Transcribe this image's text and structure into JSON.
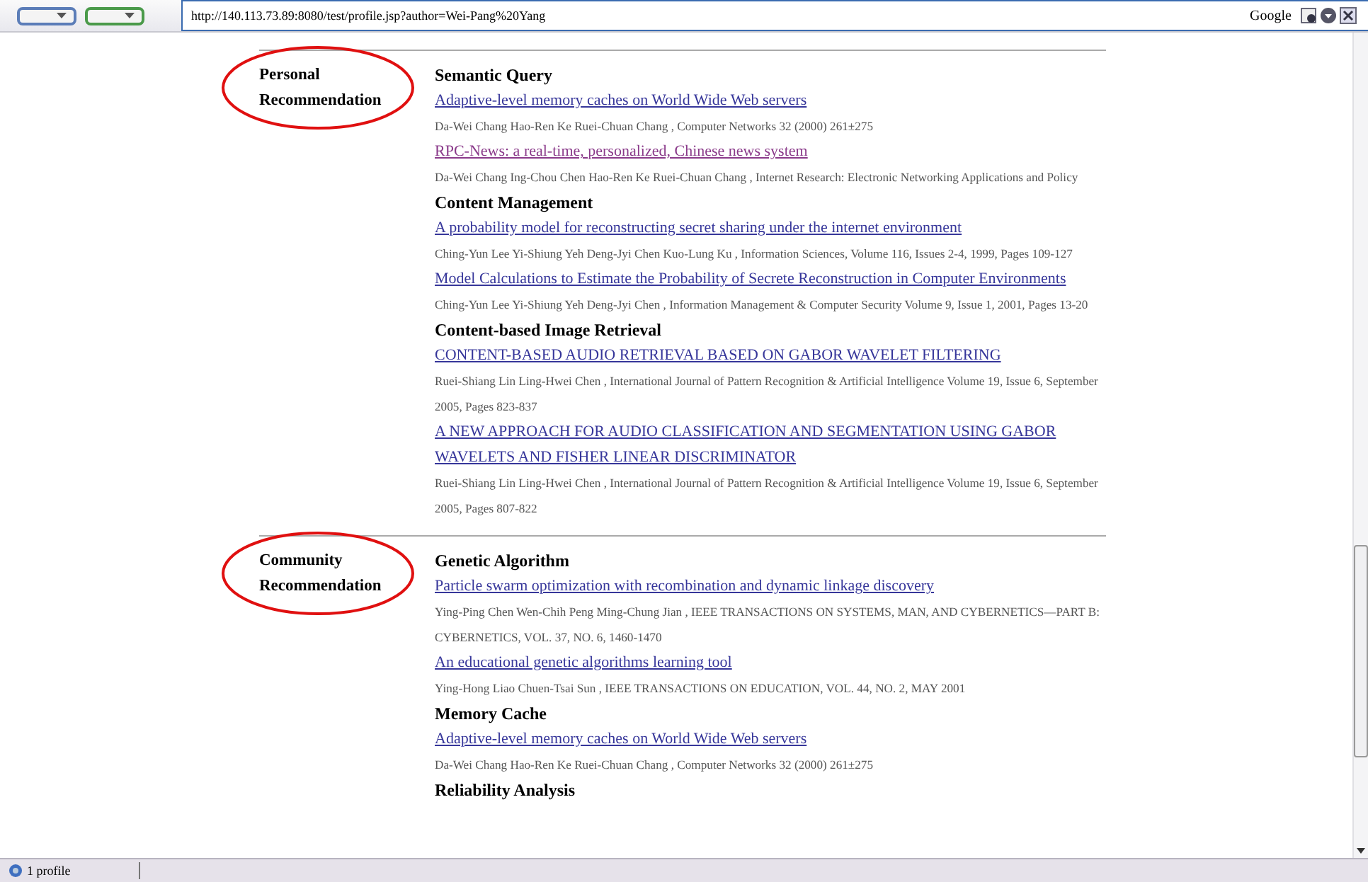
{
  "toolbar": {
    "address": "http://140.113.73.89:8080/test/profile.jsp?author=Wei-Pang%20Yang",
    "search_label": "Google"
  },
  "sections": [
    {
      "label": "Personal Recommendation",
      "groups": [
        {
          "topic": "Semantic Query",
          "papers": [
            {
              "title": "Adaptive-level memory caches on World Wide Web servers",
              "visited": false,
              "meta": "Da-Wei Chang Hao-Ren Ke Ruei-Chuan Chang , Computer Networks 32 (2000) 261±275"
            },
            {
              "title": "RPC-News: a real-time, personalized, Chinese news system",
              "visited": true,
              "meta": "Da-Wei Chang Ing-Chou Chen Hao-Ren Ke Ruei-Chuan Chang , Internet Research: Electronic Networking Applications and Policy"
            }
          ]
        },
        {
          "topic": "Content Management",
          "papers": [
            {
              "title": "A probability model for reconstructing secret sharing under the internet environment",
              "visited": false,
              "meta": "Ching-Yun Lee Yi-Shiung Yeh Deng-Jyi Chen Kuo-Lung Ku , Information Sciences, Volume 116, Issues 2-4, 1999, Pages 109-127"
            },
            {
              "title": "Model Calculations to Estimate the Probability of Secrete Reconstruction in Computer Environments",
              "visited": false,
              "meta": "Ching-Yun Lee Yi-Shiung Yeh Deng-Jyi Chen , Information Management & Computer Security Volume 9, Issue 1, 2001, Pages 13-20"
            }
          ]
        },
        {
          "topic": "Content-based Image Retrieval",
          "papers": [
            {
              "title": "CONTENT-BASED AUDIO RETRIEVAL BASED ON GABOR WAVELET FILTERING",
              "visited": false,
              "meta": "Ruei-Shiang Lin Ling-Hwei Chen , International Journal of Pattern Recognition & Artificial Intelligence Volume 19, Issue 6, September 2005, Pages 823-837"
            },
            {
              "title": "A NEW APPROACH FOR AUDIO CLASSIFICATION AND SEGMENTATION USING GABOR WAVELETS AND FISHER LINEAR DISCRIMINATOR",
              "visited": false,
              "meta": "Ruei-Shiang Lin Ling-Hwei Chen , International Journal of Pattern Recognition & Artificial Intelligence Volume 19, Issue 6, September 2005, Pages 807-822"
            }
          ]
        }
      ]
    },
    {
      "label": "Community Recommendation",
      "groups": [
        {
          "topic": "Genetic Algorithm",
          "papers": [
            {
              "title": "Particle swarm optimization with recombination and dynamic linkage discovery",
              "visited": false,
              "meta": "Ying-Ping Chen Wen-Chih Peng Ming-Chung Jian , IEEE TRANSACTIONS ON SYSTEMS, MAN, AND CYBERNETICS—PART B: CYBERNETICS, VOL. 37, NO. 6, 1460-1470"
            },
            {
              "title": "An educational genetic algorithms learning tool",
              "visited": false,
              "meta": "Ying-Hong Liao Chuen-Tsai Sun , IEEE TRANSACTIONS ON EDUCATION, VOL. 44, NO. 2, MAY 2001"
            }
          ]
        },
        {
          "topic": "Memory Cache",
          "papers": [
            {
              "title": "Adaptive-level memory caches on World Wide Web servers",
              "visited": false,
              "meta": "Da-Wei Chang Hao-Ren Ke Ruei-Chuan Chang , Computer Networks 32 (2000) 261±275"
            }
          ]
        },
        {
          "topic": "Reliability Analysis"
        }
      ]
    }
  ],
  "status_bar": {
    "text": "1 profile"
  }
}
